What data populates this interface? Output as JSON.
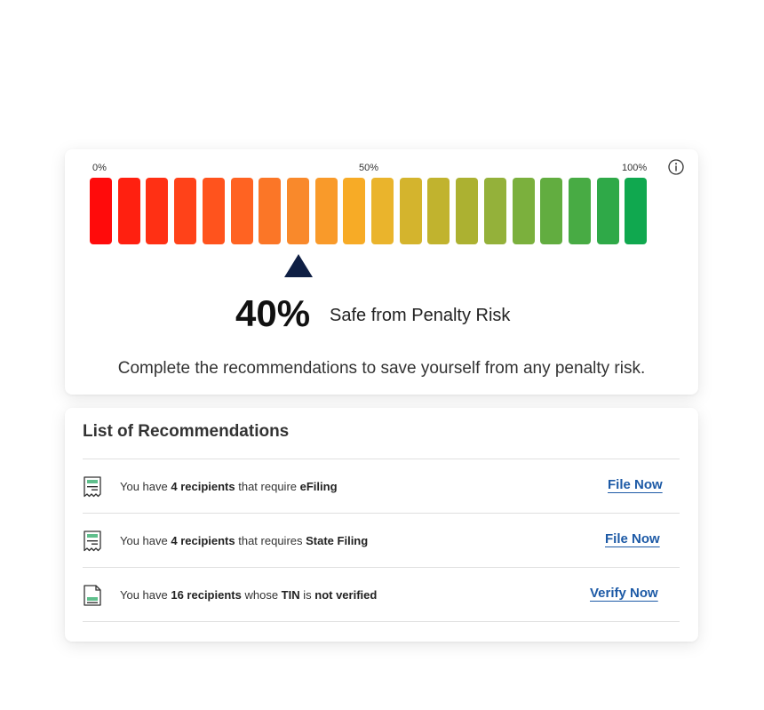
{
  "gauge": {
    "scale": {
      "min_label": "0%",
      "mid_label": "50%",
      "max_label": "100%"
    },
    "value_percent": 40,
    "percent_text": "40%",
    "status_label": "Safe from Penalty Risk",
    "instruction": "Complete the recommendations to save yourself from any penalty risk.",
    "colors": [
      "#ff0b0b",
      "#ff2010",
      "#ff3014",
      "#ff4219",
      "#ff531d",
      "#ff6322",
      "#fb7627",
      "#f9892b",
      "#f99a2a",
      "#f7ab26",
      "#eab42c",
      "#d4b42d",
      "#c1b32e",
      "#acb131",
      "#94b13a",
      "#7bb03d",
      "#62ad40",
      "#48ab44",
      "#2fa948",
      "#10a84f"
    ],
    "pointer_color": "#0f1f44"
  },
  "recommendations": {
    "title": "List of Recommendations",
    "items": [
      {
        "icon": "receipt-icon",
        "prefix": "You have ",
        "count": "4 recipients",
        "mid": " that require ",
        "subject": "eFiling",
        "tail": "",
        "tail_bold": "",
        "action": "File Now"
      },
      {
        "icon": "receipt-icon",
        "prefix": "You have ",
        "count": "4 recipients",
        "mid": " that requires ",
        "subject": "State Filing",
        "tail": "",
        "tail_bold": "",
        "action": "File Now"
      },
      {
        "icon": "document-icon",
        "prefix": "You have ",
        "count": "16 recipients",
        "mid": " whose ",
        "subject": "TIN",
        "tail": " is ",
        "tail_bold": "not verified",
        "action": "Verify Now"
      }
    ]
  }
}
